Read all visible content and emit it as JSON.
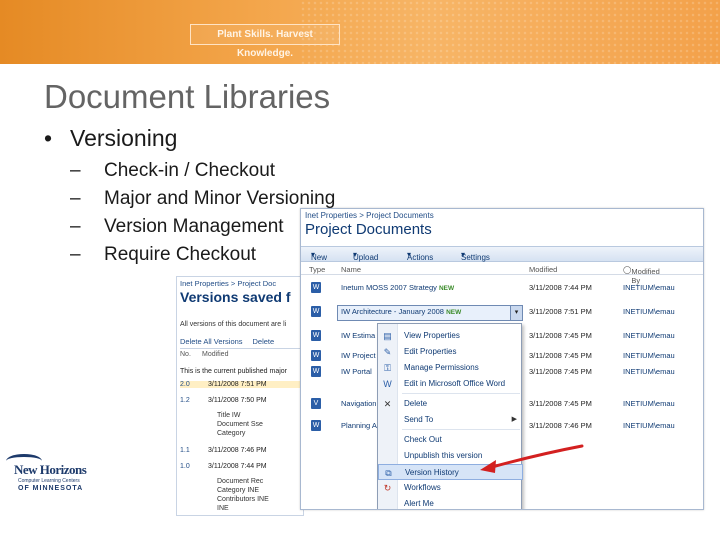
{
  "banner": {
    "tagline": "Plant Skills. Harvest Knowledge."
  },
  "slide": {
    "title": "Document Libraries",
    "bullet": "Versioning",
    "bullet_glyph": "•",
    "dash_glyph": "–",
    "subitems": [
      "Check-in / Checkout",
      "Major and Minor Versioning",
      "Version Management",
      "Require Checkout"
    ]
  },
  "logo": {
    "name": "New Horizons",
    "line1": "Computer Learning Centers",
    "line2": "OF MINNESOTA"
  },
  "versions_shot": {
    "breadcrumb": "Inet Properties > Project Doc",
    "heading": "Versions saved f",
    "description": "All versions of this document are li",
    "toolbar": [
      "Delete All Versions",
      "Delete"
    ],
    "headers": [
      "No.",
      "Modified"
    ],
    "current_note": "This is the current published major",
    "rows": [
      {
        "no": "2.0",
        "modified": "3/11/2008 7:51 PM",
        "highlight": true
      },
      {
        "no": "1.2",
        "modified": "3/11/2008 7:50 PM",
        "highlight": false
      },
      {
        "no": "1.1",
        "modified": "3/11/2008 7:46 PM",
        "highlight": false
      },
      {
        "no": "1.0",
        "modified": "3/11/2008 7:44 PM",
        "highlight": false
      }
    ],
    "meta_a": [
      "Title",
      "Document",
      "Category"
    ],
    "meta_a_values": [
      "IW",
      "Sse"
    ],
    "meta_b": [
      "Document",
      "Category",
      "Contributors"
    ],
    "meta_b_values": [
      "Rec",
      "INE",
      "INE",
      "INE"
    ]
  },
  "library_shot": {
    "breadcrumb": "Inet Properties > Project Documents",
    "heading": "Project Documents",
    "toolbar": {
      "new": "New",
      "upload": "Upload",
      "actions": "Actions",
      "settings": "Settings"
    },
    "columns": {
      "type": "Type",
      "name": "Name",
      "modified": "Modified",
      "modified_by": "Modified By"
    },
    "new_badge": "NEW",
    "docs": [
      {
        "name": "Inetum MOSS 2007 Strategy",
        "new": true,
        "modified": "3/11/2008 7:44 PM",
        "by": "INETIUM\\emau"
      },
      {
        "name": "IW Architecture - January 2008",
        "new": true,
        "modified": "3/11/2008 7:51 PM",
        "by": "INETIUM\\emau"
      },
      {
        "name": "IW Estima",
        "new": false,
        "modified": "3/11/2008 7:45 PM",
        "by": "INETIUM\\emau"
      },
      {
        "name": "IW Project",
        "new": false,
        "modified": "3/11/2008 7:45 PM",
        "by": "INETIUM\\emau"
      },
      {
        "name": "IW Portal",
        "new": false,
        "modified": "3/11/2008 7:45 PM",
        "by": "INETIUM\\emau"
      },
      {
        "name": "Navigation",
        "new": false,
        "modified": "3/11/2008 7:45 PM",
        "by": "INETIUM\\emau"
      },
      {
        "name": "Planning A",
        "new": false,
        "modified": "3/11/2008 7:46 PM",
        "by": "INETIUM\\emau"
      }
    ],
    "context_menu": [
      {
        "label": "View Properties",
        "icon": "properties-icon"
      },
      {
        "label": "Edit Properties",
        "icon": "edit-properties-icon"
      },
      {
        "label": "Manage Permissions",
        "icon": "permissions-icon"
      },
      {
        "label": "Edit in Microsoft Office Word",
        "icon": "word-icon"
      },
      {
        "label": "Delete",
        "icon": "delete-icon"
      },
      {
        "label": "Send To",
        "icon": "send-to-icon",
        "submenu": true
      },
      {
        "label": "Check Out",
        "icon": "check-out-icon"
      },
      {
        "label": "Unpublish this version",
        "icon": "unpublish-icon"
      },
      {
        "label": "Version History",
        "icon": "version-history-icon",
        "active": true
      },
      {
        "label": "Workflows",
        "icon": "workflows-icon"
      },
      {
        "label": "Alert Me",
        "icon": "alert-icon"
      }
    ]
  },
  "colors": {
    "banner": "#f3a54a",
    "title": "#646464",
    "sharepoint_blue": "#0f3a73",
    "arrow": "#d32020"
  }
}
